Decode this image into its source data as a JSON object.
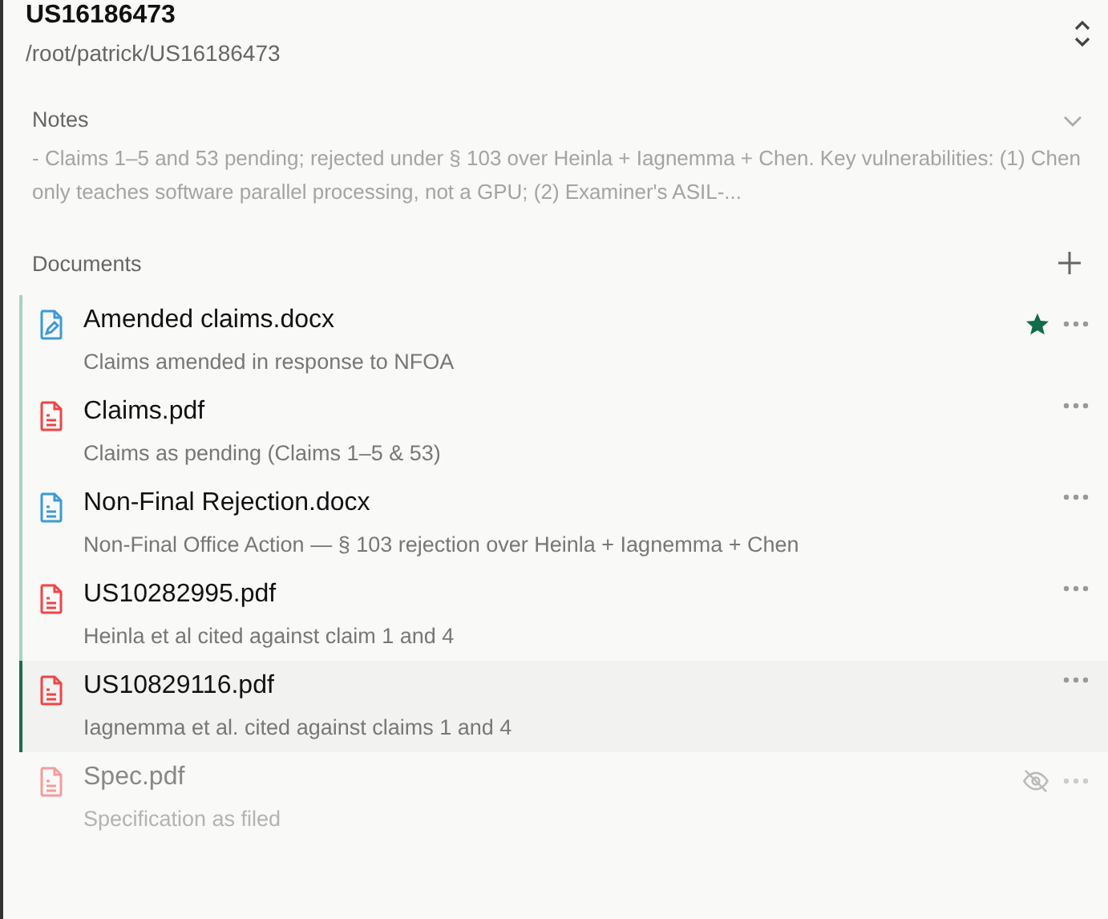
{
  "header": {
    "title": "US16186473",
    "path": "/root/patrick/US16186473"
  },
  "notes": {
    "label": "Notes",
    "expanded": true,
    "text": "- Claims 1–5 and 53 pending; rejected under § 103 over Heinla + Iagnemma + Chen. Key vulnerabilities: (1) Chen only teaches software parallel processing, not a GPU; (2) Examiner's ASIL-..."
  },
  "documents": {
    "label": "Documents",
    "items": [
      {
        "name": "Amended claims.docx",
        "description": "Claims amended in response to NFOA",
        "kind": "edit",
        "starred": true,
        "selected": false,
        "hidden": false
      },
      {
        "name": "Claims.pdf",
        "description": "Claims as pending (Claims 1–5 & 53)",
        "kind": "pdf",
        "starred": false,
        "selected": false,
        "hidden": false
      },
      {
        "name": "Non-Final Rejection.docx",
        "description": "Non-Final Office Action — § 103 rejection over Heinla + Iagnemma + Chen",
        "kind": "doc",
        "starred": false,
        "selected": false,
        "hidden": false
      },
      {
        "name": "US10282995.pdf",
        "description": "Heinla et al cited against claim 1 and 4",
        "kind": "pdf",
        "starred": false,
        "selected": false,
        "hidden": false
      },
      {
        "name": "US10829116.pdf",
        "description": "Iagnemma et al. cited against claims 1 and 4",
        "kind": "pdf",
        "starred": false,
        "selected": true,
        "hidden": false
      },
      {
        "name": "Spec.pdf",
        "description": "Specification as filed",
        "kind": "pdf",
        "starred": false,
        "selected": false,
        "hidden": true
      }
    ]
  }
}
